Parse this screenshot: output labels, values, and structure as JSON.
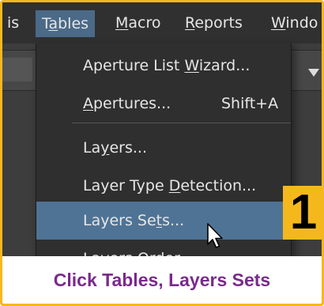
{
  "menubar": {
    "items": [
      {
        "label": "is"
      },
      {
        "pre": "T",
        "u": "a",
        "post": "bles"
      },
      {
        "pre": "",
        "u": "M",
        "post": "acro"
      },
      {
        "pre": "",
        "u": "R",
        "post": "eports"
      },
      {
        "pre": "",
        "u": "W",
        "post": "indo"
      }
    ]
  },
  "menu": {
    "items": [
      {
        "pre": "Aperture List ",
        "u": "W",
        "post": "izard..."
      },
      {
        "pre": "",
        "u": "A",
        "post": "pertures...",
        "shortcut": "Shift+A"
      },
      {
        "pre": "La",
        "u": "y",
        "post": "ers..."
      },
      {
        "pre": "Layer Type ",
        "u": "D",
        "post": "etection..."
      },
      {
        "pre": "Layers Se",
        "u": "t",
        "post": "s..."
      },
      {
        "label": "Layers Order"
      }
    ]
  },
  "step_number": "1",
  "caption": "Click Tables, Layers Sets",
  "colors": {
    "border": "#f5b81c",
    "highlight": "#4f7395",
    "caption_text": "#7a2a8c"
  }
}
